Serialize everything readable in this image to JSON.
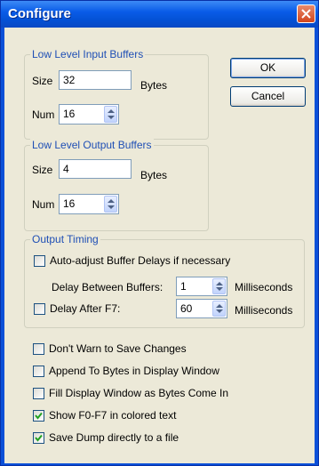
{
  "window": {
    "title": "Configure"
  },
  "input_buffers": {
    "group_label": "Low Level Input Buffers",
    "size_label": "Size",
    "size_value": "32",
    "size_unit": "Bytes",
    "num_label": "Num",
    "num_value": "16"
  },
  "output_buffers": {
    "group_label": "Low Level Output Buffers",
    "size_label": "Size",
    "size_value": "4",
    "size_unit": "Bytes",
    "num_label": "Num",
    "num_value": "16"
  },
  "output_timing": {
    "group_label": "Output Timing",
    "auto_adjust": {
      "label": "Auto-adjust Buffer Delays if necessary",
      "checked": false
    },
    "delay_between_label": "Delay Between Buffers:",
    "delay_between_value": "1",
    "delay_between_unit": "Milliseconds",
    "delay_after": {
      "label": "Delay After F7:",
      "checked": false
    },
    "delay_after_value": "60",
    "delay_after_unit": "Milliseconds"
  },
  "buttons": {
    "ok": "OK",
    "cancel": "Cancel"
  },
  "options": [
    {
      "label": "Don't Warn to Save Changes",
      "checked": false
    },
    {
      "label": "Append To Bytes in Display Window",
      "checked": false
    },
    {
      "label": "Fill Display Window as Bytes Come In",
      "checked": false
    },
    {
      "label": "Show F0-F7 in colored text",
      "checked": true
    },
    {
      "label": "Save Dump directly to a file",
      "checked": true
    }
  ]
}
